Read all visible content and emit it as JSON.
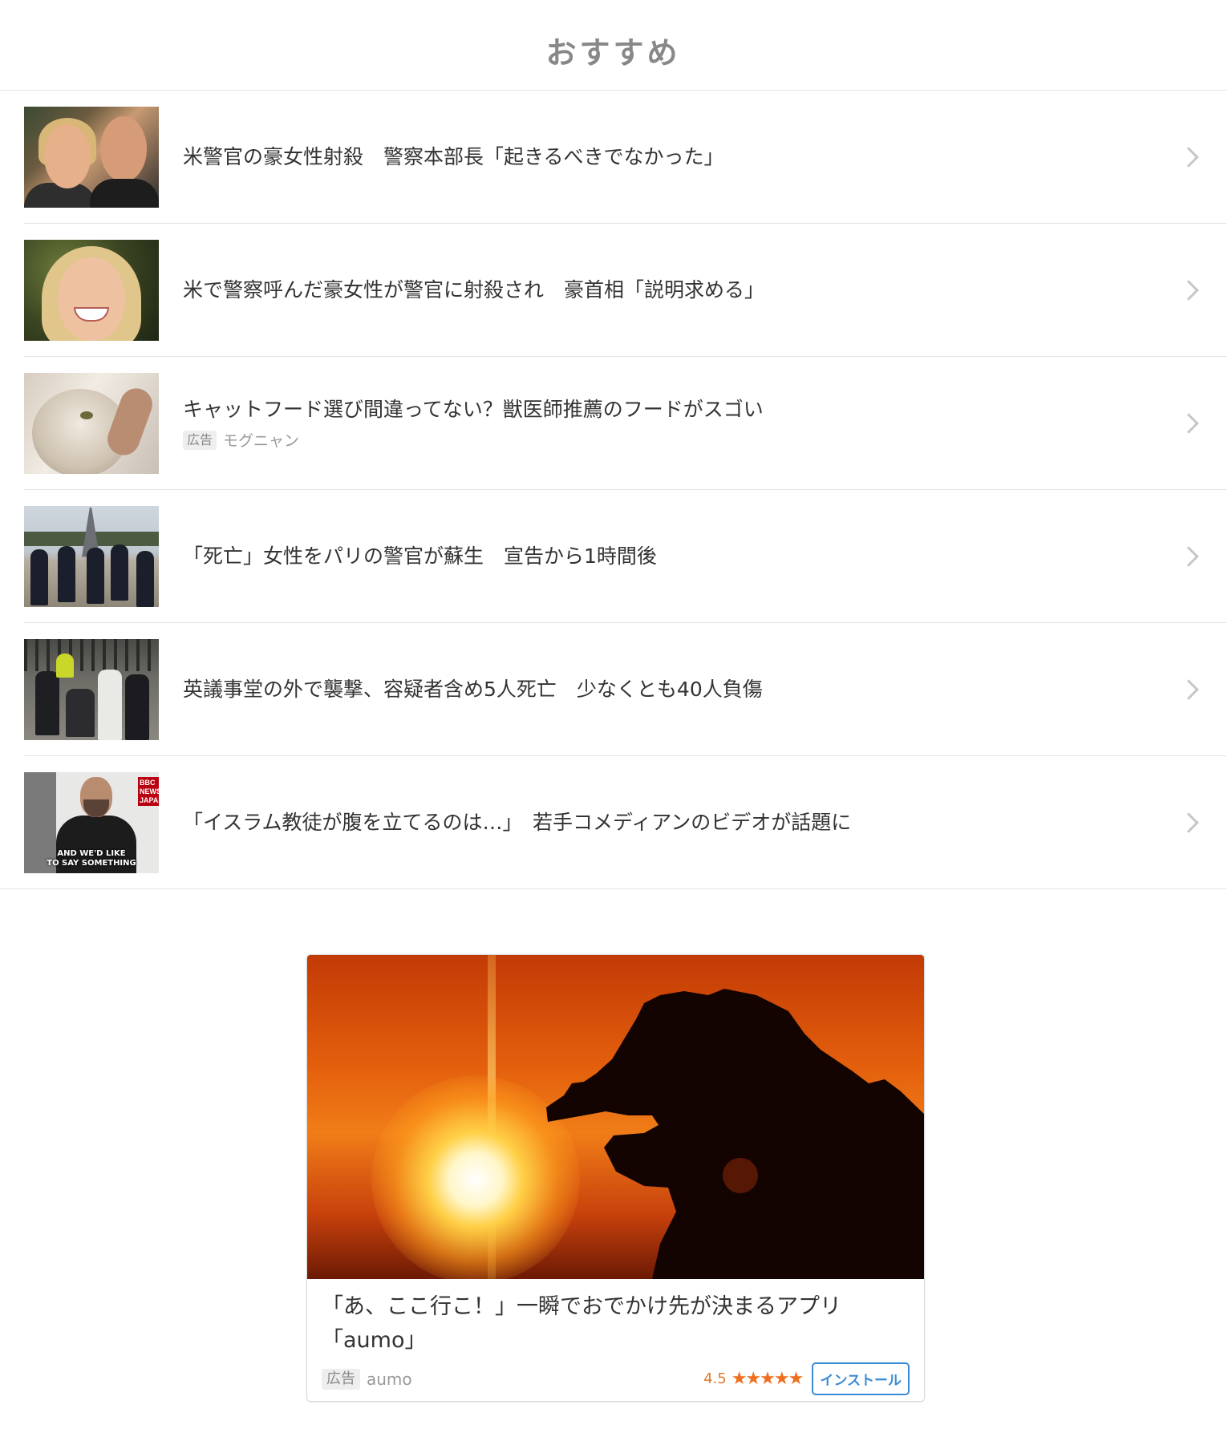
{
  "section": {
    "title": "おすすめ"
  },
  "articles": [
    {
      "title": "米警官の豪女性射殺　警察本部長「起きるべきでなかった」"
    },
    {
      "title": "米で警察呼んだ豪女性が警官に射殺され　豪首相「説明求める」"
    },
    {
      "title": "キャットフード選び間違ってない？獣医師推薦のフードがスゴい",
      "ad_badge": "広告",
      "ad_source": "モグニャン"
    },
    {
      "title": "「死亡」女性をパリの警官が蘇生　宣告から1時間後"
    },
    {
      "title": "英議事堂の外で襲撃、容疑者含め5人死亡　少なくとも40人負傷"
    },
    {
      "title": "「イスラム教徒が腹を立てるのは…」　若手コメディアンのビデオが話題に",
      "thumb_caption": "AND WE'D LIKE\nTO SAY SOMETHING",
      "thumb_logo": "BBC NEWS JAPAN"
    }
  ],
  "ad_card": {
    "title": "「あ、ここ行こ！」一瞬でおでかけ先が決まるアプリ\n「aumo」",
    "ad_badge": "広告",
    "source": "aumo",
    "rating": "4.5",
    "stars": "★★★★★",
    "install_label": "インストール"
  },
  "colors": {
    "star": "#ef6f1f",
    "install_border": "#3b8cd6"
  }
}
